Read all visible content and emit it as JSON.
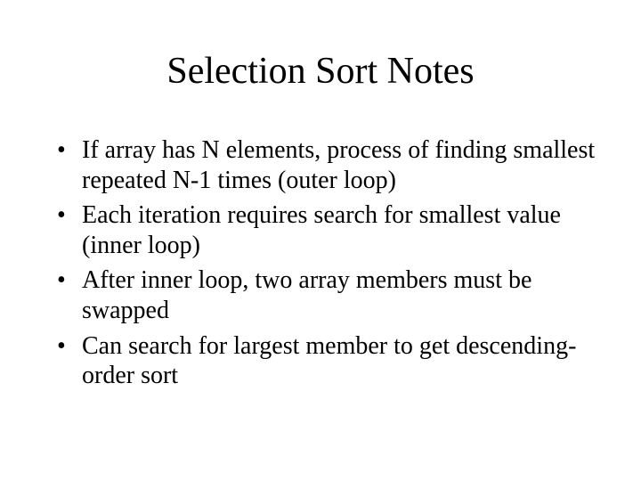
{
  "slide": {
    "title": "Selection Sort Notes",
    "bullets": [
      "If array has N elements, process of finding smallest repeated N-1 times (outer loop)",
      "Each iteration requires search for smallest value (inner loop)",
      "After inner loop, two array members must be swapped",
      "Can search for largest member to get descending-order sort"
    ]
  }
}
